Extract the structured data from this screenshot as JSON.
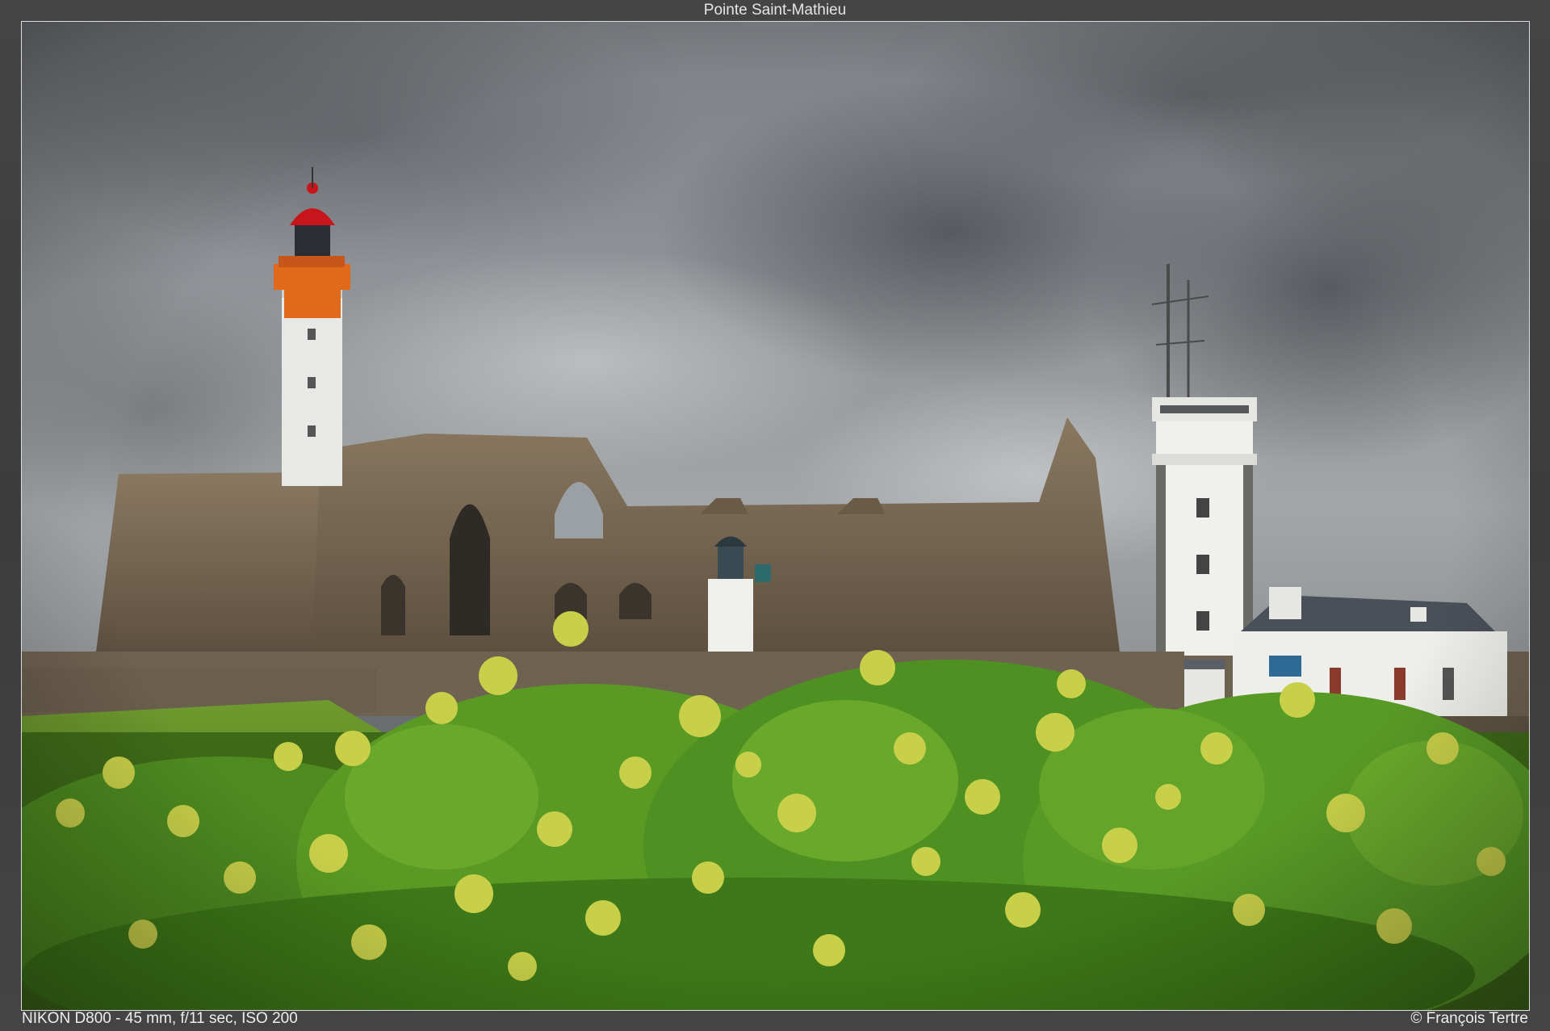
{
  "page": {
    "title": "Pointe Saint-Mathieu"
  },
  "photo": {
    "alt": "Pointe Saint-Mathieu",
    "camera_info": "NIKON D800 - 45 mm, f/11 sec, ISO 200",
    "credit": "© François Tertre"
  },
  "colors": {
    "background": "#3a3a3a",
    "frame_border": "#dcdcdc",
    "caption_text": "#eeeeee",
    "lighthouse_red": "#c8151b",
    "lighthouse_orange": "#e06a1a",
    "sky_grey": "#8a8e92",
    "stone_brown": "#7e6a52",
    "ivy_green": "#5a9a24",
    "ivy_flower_yellow": "#c8d04a"
  }
}
